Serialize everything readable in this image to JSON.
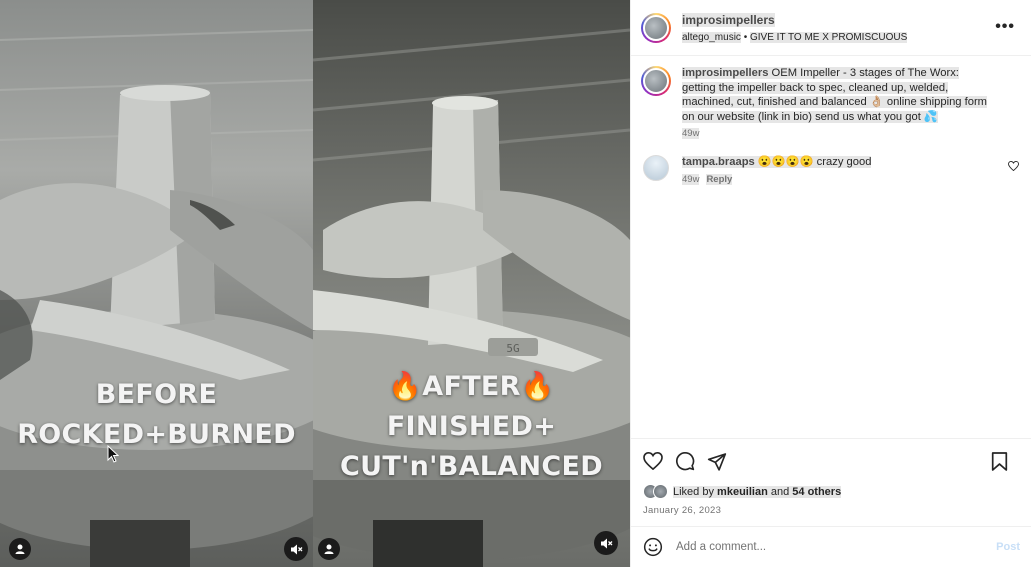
{
  "post": {
    "username": "improsimpellers",
    "audio_artist": "altego_music",
    "audio_separator": " • ",
    "audio_track": "GIVE IT TO ME X PROMISCUOUS",
    "more_icon": "more-options-icon"
  },
  "media": {
    "left_caption_line1": "BEFORE",
    "left_caption_line2": "ROCKED+BURNED",
    "right_caption_line1": "AFTER",
    "right_caption_line2": "FINISHED+",
    "right_caption_line3": "CUT'n'BALANCED",
    "fire_emoji": "🔥",
    "icons": [
      "user-tag-icon",
      "mute-icon"
    ]
  },
  "caption": {
    "username": "improsimpellers",
    "text": "OEM Impeller - 3 stages of The Worx: getting the impeller back to spec, cleaned up, welded, machined, cut, finished and balanced 👌🏼 online shipping form on our website (link in bio) send us what you got 💦",
    "age": "49w"
  },
  "comments": [
    {
      "username": "tampa.braaps",
      "text": "😮😮😮😮 crazy good",
      "age": "49w",
      "reply_label": "Reply"
    }
  ],
  "actions": {
    "icons": [
      "heart-icon",
      "comment-icon",
      "share-icon",
      "bookmark-icon"
    ]
  },
  "likes": {
    "prefix": "Liked by",
    "first_user": "mkeuilian",
    "joiner": "and",
    "others": "54 others"
  },
  "date": "January 26, 2023",
  "add_comment": {
    "placeholder": "Add a comment...",
    "post_label": "Post",
    "emoji_icon": "emoji-icon"
  },
  "colors": {
    "accent_disabled": "#c8dff7",
    "text_primary": "#262626",
    "text_secondary": "#737373",
    "fire": "#ff6a13"
  }
}
